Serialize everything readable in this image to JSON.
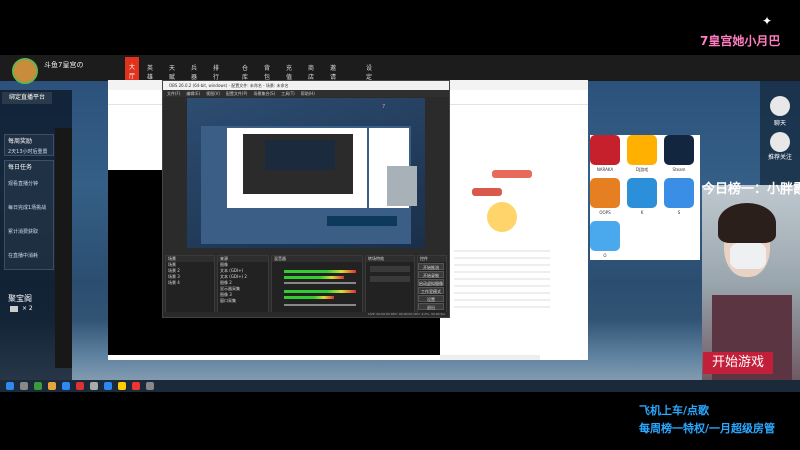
{
  "overlay": {
    "top_right_text": "7皇宫她小月巴",
    "rank_text": "今日榜一：小胖霞",
    "start_game": "开始游戏",
    "bottom_line1": "飞机上车/点歌",
    "bottom_line2": "每周榜一特权/一月超级房管"
  },
  "stream": {
    "channel_title": "斗鱼7皇宫の",
    "tabs": [
      "大厅",
      "英雄",
      "天赋",
      "兵器",
      "排行榜",
      "仓库",
      "背包",
      "充值",
      "商店",
      "邀请有奖",
      "设定及赛间"
    ],
    "active_tab": "大厅"
  },
  "left_panel": {
    "bind_label": "绑定直播平台",
    "weekly_reward": "每周奖励",
    "weekly_sub": "2天13小时后重置",
    "daily_task": "每日任务",
    "task1": "观看直播分钟",
    "task2": "每日完成1场挑战",
    "task3": "累计消费获取",
    "task4": "在直播中消耗",
    "treasure": "聚宝阁",
    "treasure_count": "× 2"
  },
  "right_panel": {
    "item1": "聊天",
    "item2": "推荐关注",
    "item3": "三排"
  },
  "obs": {
    "window_title": "OBS 26.0.2 (64-bit, windows) - 配置文件: 未命名 - 场景: 未命名",
    "menu": [
      "文件(F)",
      "编辑(E)",
      "视图(V)",
      "配置文件(P)",
      "场景集合(S)",
      "工具(T)",
      "帮助(H)"
    ],
    "docks": {
      "scenes": "场景",
      "sources": "来源",
      "mixer": "混音器",
      "transitions": "转场特效",
      "controls": "控件"
    },
    "scene_items": [
      "场景",
      "场景 2",
      "场景 3",
      "场景 4"
    ],
    "source_items": [
      "图像",
      "文本 (GDI+)",
      "文本 (GDI+) 2",
      "图像 2",
      "显示器采集",
      "图像 3",
      "窗口采集"
    ],
    "control_buttons": [
      "开始推流",
      "开始录制",
      "启动虚拟摄像机",
      "工作室模式",
      "设置",
      "退出"
    ],
    "status_bar": "LIVE: 00:00:00   REC: 00:00:00   CPU: 4.2%, 30.00 fps"
  },
  "apps": [
    {
      "name": "NARAKA",
      "color": "#c6202c"
    },
    {
      "name": "DJ游戏",
      "color": "#ffb000"
    },
    {
      "name": "Steam",
      "color": "#13263f"
    },
    {
      "name": "OOPS",
      "color": "#e67e22"
    },
    {
      "name": "K",
      "color": "#2b90d9"
    },
    {
      "name": "S",
      "color": "#3a8ee6"
    },
    {
      "name": "O",
      "color": "#4aa8ec"
    }
  ],
  "colors": {
    "accent_red": "#e0321d",
    "overlay_blue": "#2aa8ff",
    "pink": "#ff7ec0"
  }
}
